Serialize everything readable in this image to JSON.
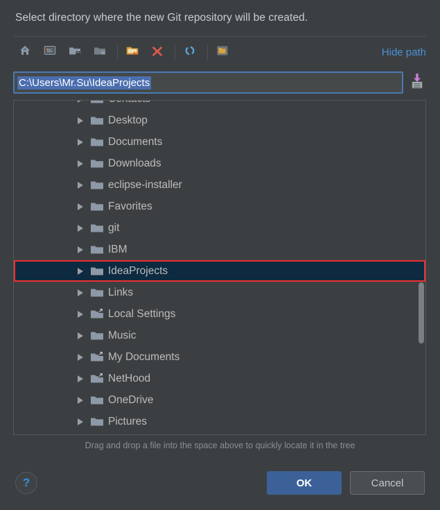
{
  "dialog": {
    "title": "Select directory where the new Git repository will be created.",
    "hint": "Drag and drop a file into the space above to quickly locate it in the tree"
  },
  "toolbar": {
    "hide_path_label": "Hide path",
    "buttons": [
      {
        "name": "home-icon",
        "title": "Home"
      },
      {
        "name": "desktop-icon",
        "title": "Desktop"
      },
      {
        "name": "project-folder-icon",
        "title": "Project Directory"
      },
      {
        "name": "folder-icon",
        "title": "Module Directory"
      },
      {
        "name": "new-folder-icon",
        "title": "New Folder"
      },
      {
        "name": "delete-icon",
        "title": "Delete"
      },
      {
        "name": "refresh-icon",
        "title": "Refresh"
      },
      {
        "name": "show-hidden-files-icon",
        "title": "Show Hidden Files"
      }
    ]
  },
  "path": {
    "value": "C:\\Users\\Mr.Su\\IdeaProjects",
    "placeholder": "",
    "save_icon": "save-to-disk-icon"
  },
  "tree": {
    "rows": [
      {
        "label": "Contacts",
        "shortcut": false,
        "selected": false
      },
      {
        "label": "Desktop",
        "shortcut": false,
        "selected": false
      },
      {
        "label": "Documents",
        "shortcut": false,
        "selected": false
      },
      {
        "label": "Downloads",
        "shortcut": false,
        "selected": false
      },
      {
        "label": "eclipse-installer",
        "shortcut": false,
        "selected": false
      },
      {
        "label": "Favorites",
        "shortcut": false,
        "selected": false
      },
      {
        "label": "git",
        "shortcut": false,
        "selected": false
      },
      {
        "label": "IBM",
        "shortcut": false,
        "selected": false
      },
      {
        "label": "IdeaProjects",
        "shortcut": false,
        "selected": true
      },
      {
        "label": "Links",
        "shortcut": false,
        "selected": false
      },
      {
        "label": "Local Settings",
        "shortcut": true,
        "selected": false
      },
      {
        "label": "Music",
        "shortcut": false,
        "selected": false
      },
      {
        "label": "My Documents",
        "shortcut": true,
        "selected": false
      },
      {
        "label": "NetHood",
        "shortcut": true,
        "selected": false
      },
      {
        "label": "OneDrive",
        "shortcut": false,
        "selected": false
      },
      {
        "label": "Pictures",
        "shortcut": false,
        "selected": false
      }
    ]
  },
  "footer": {
    "help_label": "?",
    "ok_label": "OK",
    "cancel_label": "Cancel"
  },
  "colors": {
    "background": "#3c3f41",
    "accent_blue": "#4a90d9",
    "selection_blue": "#4b6eaf",
    "selected_row_bg": "#0d2a40",
    "highlight_red": "#f03030",
    "ok_button": "#3c6199",
    "folder": "#8d99a6"
  }
}
